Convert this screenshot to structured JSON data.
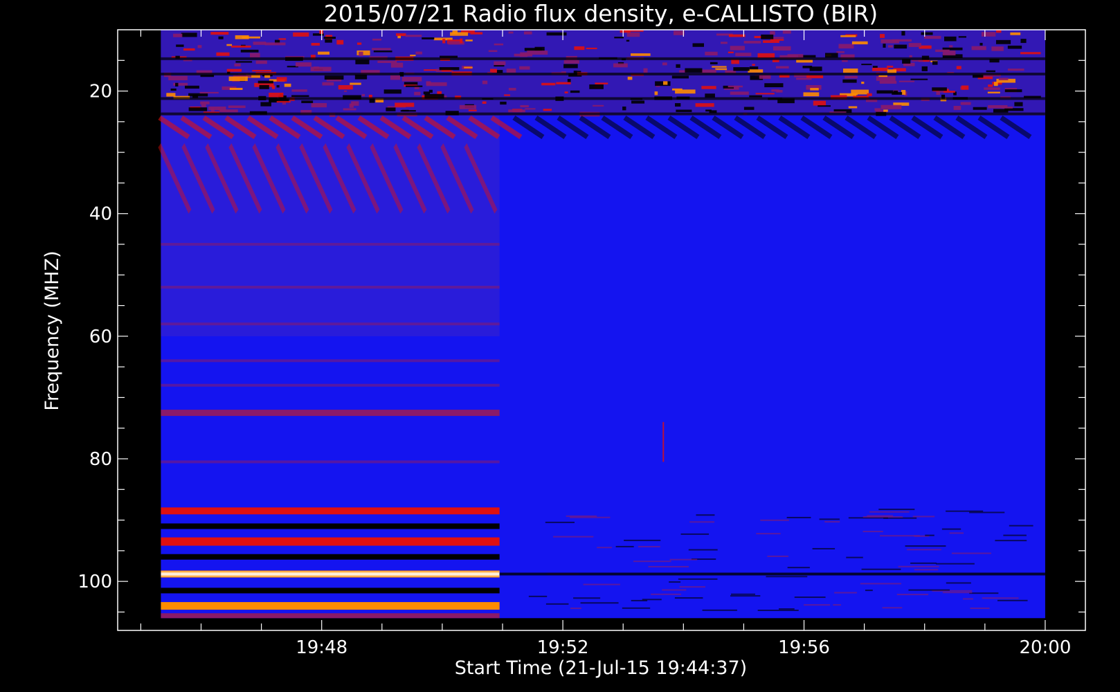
{
  "chart_data": {
    "type": "heatmap",
    "title": "2015/07/21  Radio flux density, e-CALLISTO (BIR)",
    "xlabel": "Start Time (21-Jul-15 19:44:37)",
    "ylabel": "Frequency (MHZ)",
    "x_ticks": [
      "19:48",
      "19:52",
      "19:56",
      "20:00"
    ],
    "y_ticks": [
      "20",
      "40",
      "60",
      "80",
      "100"
    ],
    "xlim": [
      "19:44:37",
      "20:00:40"
    ],
    "ylim_mhz": [
      10,
      108
    ],
    "y_axis_inverted": true,
    "data_time_range": [
      "19:45:20",
      "20:00:00"
    ],
    "data_freq_range_mhz": [
      10,
      106
    ],
    "instrument_change_time": "19:50:57",
    "colormap": [
      "#000000",
      "#2020ff",
      "#8a1a6a",
      "#e01010",
      "#ff8c00",
      "#ffff80",
      "#ffffff"
    ],
    "background_color": "#1414f0",
    "features": [
      {
        "name": "interference band",
        "freq_mhz": [
          10,
          24
        ],
        "time": [
          "19:45:20",
          "20:00:00"
        ]
      },
      {
        "name": "diagonal stripes",
        "freq_mhz": [
          24,
          40
        ],
        "time": [
          "19:45:20",
          "20:00:00"
        ]
      },
      {
        "name": "emission line",
        "freq_mhz": 72.5,
        "time": [
          "19:45:20",
          "19:50:57"
        ]
      },
      {
        "name": "emission line",
        "freq_mhz": 88.5,
        "time": [
          "19:45:20",
          "19:50:57"
        ]
      },
      {
        "name": "emission line",
        "freq_mhz": 93.5,
        "time": [
          "19:45:20",
          "19:50:57"
        ]
      },
      {
        "name": "emission line",
        "freq_mhz": 98.8,
        "time": [
          "19:45:20",
          "19:50:57"
        ]
      },
      {
        "name": "emission line",
        "freq_mhz": 104,
        "time": [
          "19:45:20",
          "19:50:57"
        ]
      }
    ]
  }
}
